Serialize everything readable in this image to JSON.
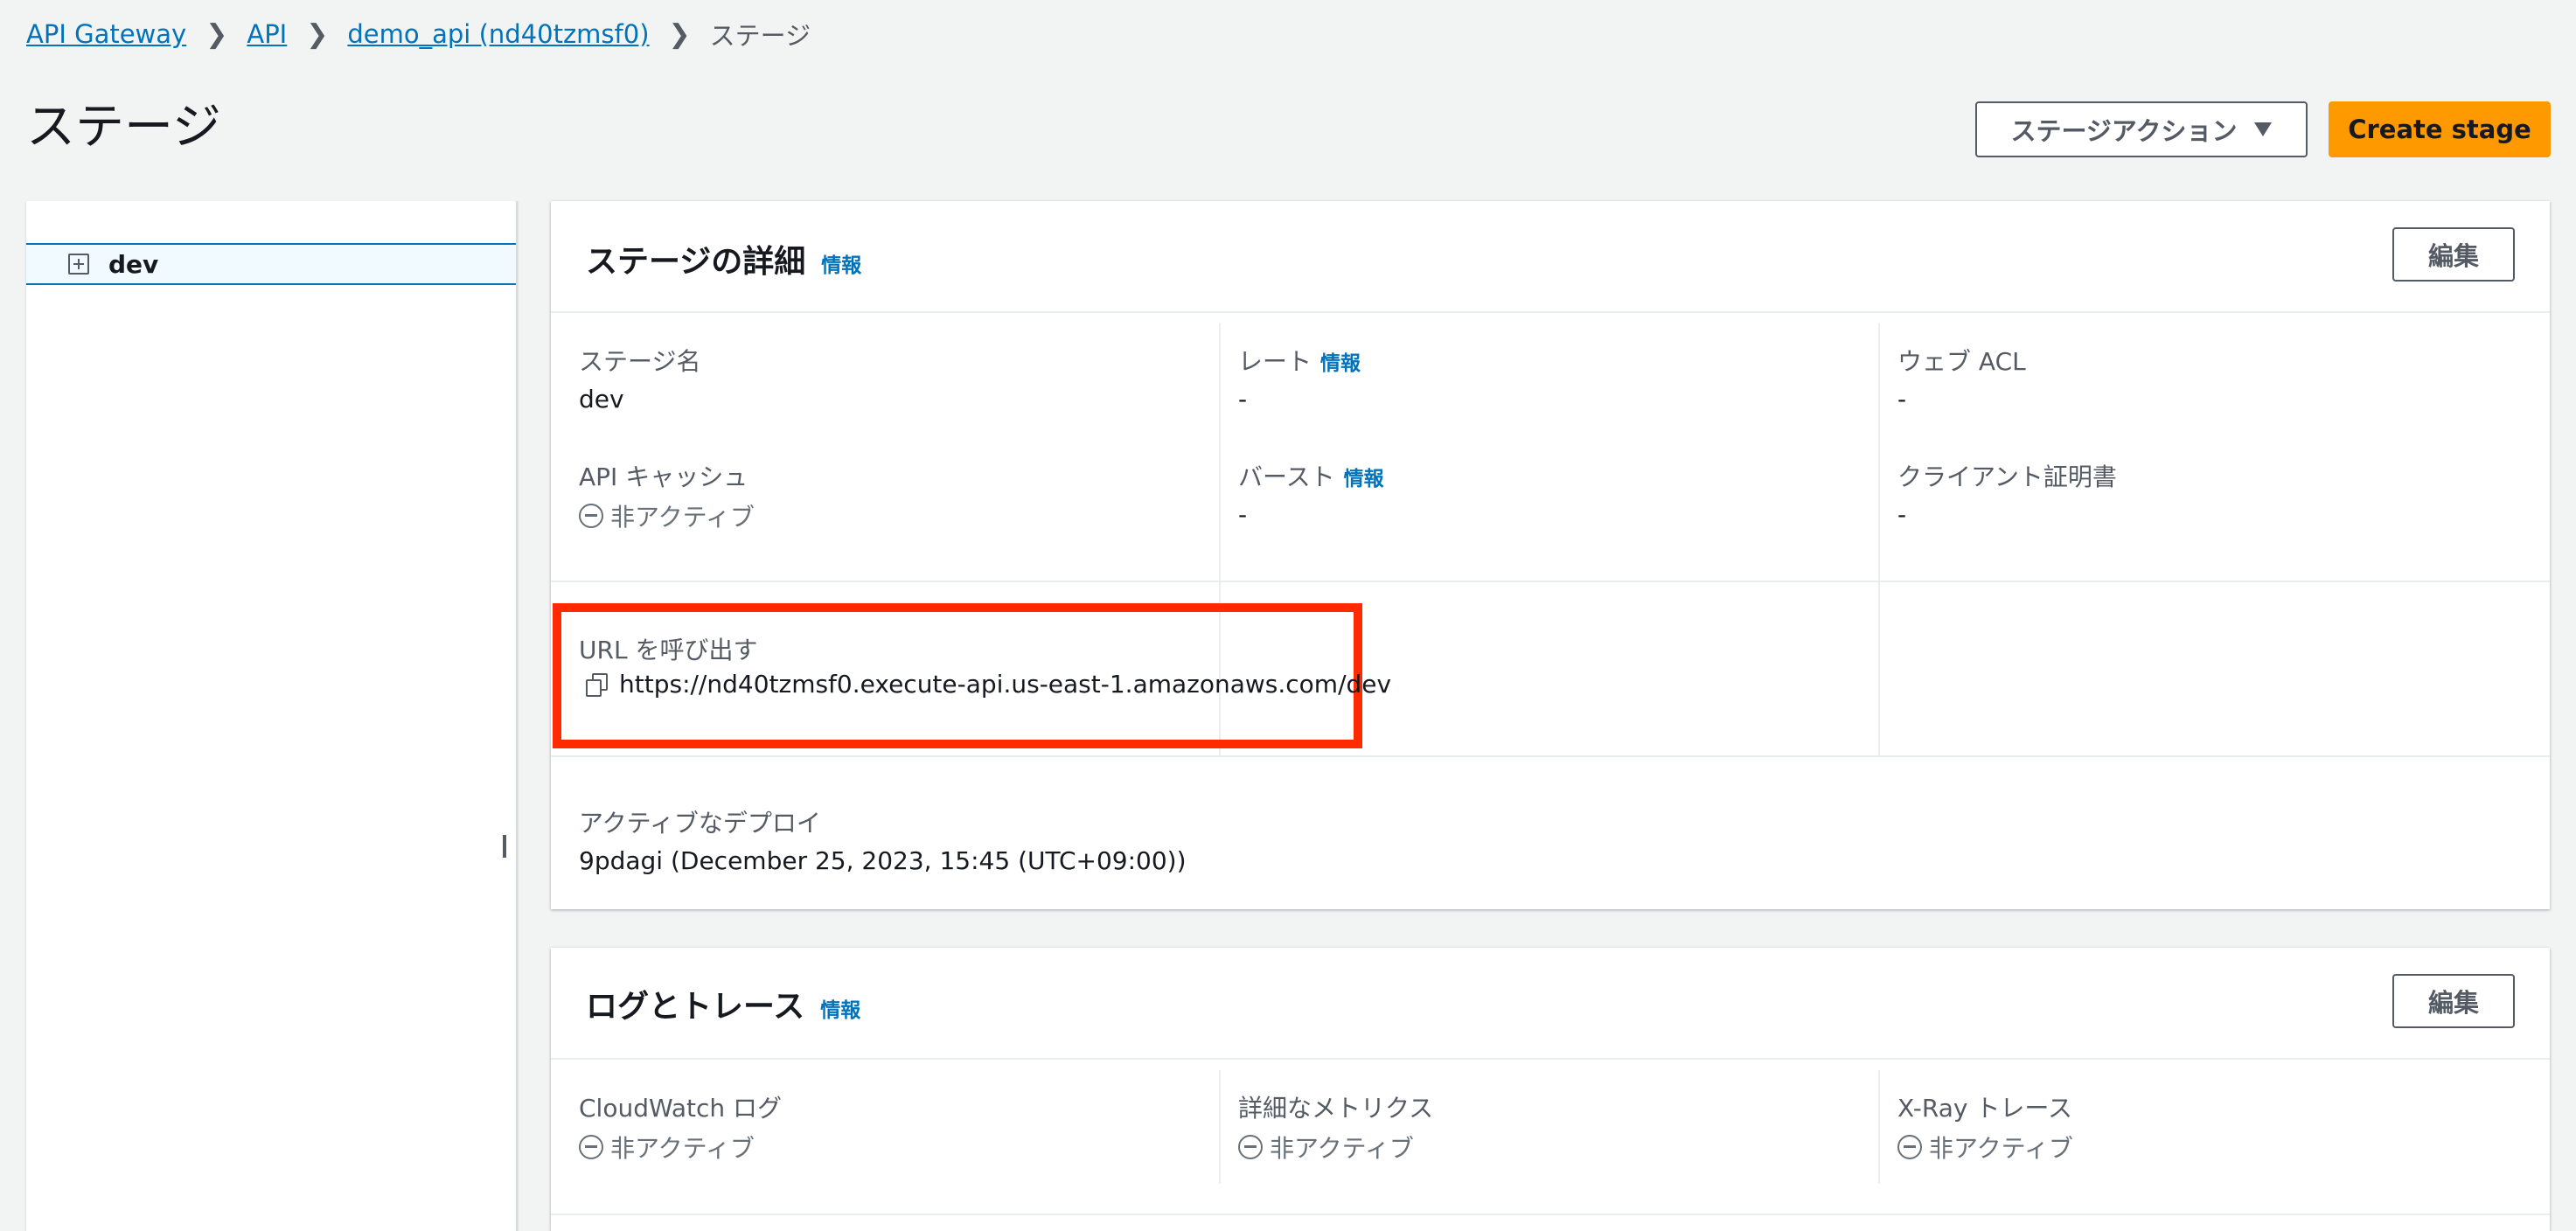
{
  "breadcrumb": {
    "items": [
      {
        "label": "API Gateway"
      },
      {
        "label": "API"
      },
      {
        "label": "demo_api (nd40tzmsf0)"
      }
    ],
    "current": "ステージ"
  },
  "page": {
    "title": "ステージ"
  },
  "actions": {
    "stage_actions_label": "ステージアクション",
    "create_stage_label": "Create stage"
  },
  "tree": {
    "items": [
      {
        "label": "dev"
      }
    ]
  },
  "stage_details": {
    "title": "ステージの詳細",
    "info_label": "情報",
    "edit_label": "編集",
    "stage_name_label": "ステージ名",
    "stage_name_value": "dev",
    "api_cache_label": "API キャッシュ",
    "api_cache_value": "非アクティブ",
    "rate_label": "レート",
    "rate_info": "情報",
    "rate_value": "-",
    "burst_label": "バースト",
    "burst_info": "情報",
    "burst_value": "-",
    "web_acl_label": "ウェブ ACL",
    "web_acl_value": "-",
    "client_cert_label": "クライアント証明書",
    "client_cert_value": "-",
    "invoke_url_label": "URL を呼び出す",
    "invoke_url_value": "https://nd40tzmsf0.execute-api.us-east-1.amazonaws.com/dev",
    "active_deploy_label": "アクティブなデプロイ",
    "active_deploy_value": "9pdagi (December 25, 2023, 15:45 (UTC+09:00))"
  },
  "logs": {
    "title": "ログとトレース",
    "info_label": "情報",
    "edit_label": "編集",
    "cloudwatch_label": "CloudWatch ログ",
    "cloudwatch_value": "非アクティブ",
    "metrics_label": "詳細なメトリクス",
    "metrics_value": "非アクティブ",
    "xray_label": "X-Ray トレース",
    "xray_value": "非アクティブ"
  },
  "colors": {
    "primary": "#ff9900",
    "link": "#0073bb",
    "highlight": "#ff2a00"
  }
}
